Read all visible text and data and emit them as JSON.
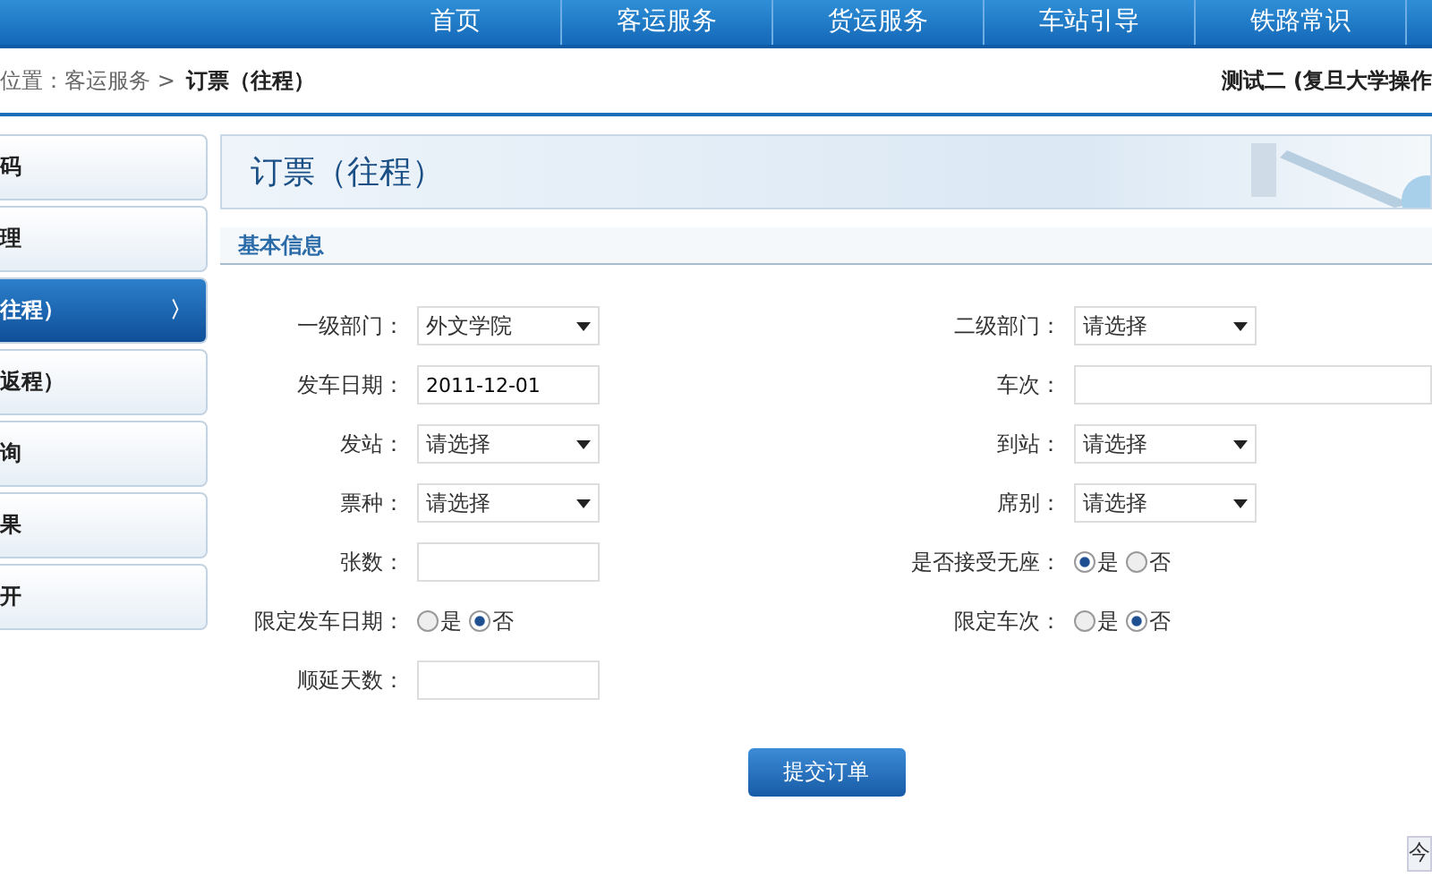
{
  "nav": [
    {
      "label": "首页"
    },
    {
      "label": "客运服务"
    },
    {
      "label": "货运服务"
    },
    {
      "label": "车站引导"
    },
    {
      "label": "铁路常识"
    }
  ],
  "breadcrumb": {
    "path": "位置：客运服务",
    "separator": ">",
    "current": "订票（往程）"
  },
  "user": "测试二 (复旦大学操作",
  "sidebar": {
    "items": [
      {
        "label": "码",
        "selected": false
      },
      {
        "label": "理",
        "selected": false
      },
      {
        "label": "往程）",
        "selected": true,
        "arrow": "〉"
      },
      {
        "label": "返程）",
        "selected": false
      },
      {
        "label": "询",
        "selected": false
      },
      {
        "label": "果",
        "selected": false
      },
      {
        "label": "开",
        "selected": false
      }
    ]
  },
  "page_title": "订票（往程）",
  "section_title": "基本信息",
  "form_rows": [
    {
      "left": {
        "label": "一级部门：",
        "kind": "select",
        "value": "外文学院"
      },
      "right": {
        "label": "二级部门：",
        "kind": "select",
        "value": "请选择"
      }
    },
    {
      "left": {
        "label": "发车日期：",
        "kind": "text",
        "value": "2011-12-01"
      },
      "right": {
        "label": "车次：",
        "kind": "wide"
      }
    },
    {
      "left": {
        "label": "发站：",
        "kind": "select",
        "value": "请选择"
      },
      "right": {
        "label": "到站：",
        "kind": "select",
        "value": "请选择"
      }
    },
    {
      "left": {
        "label": "票种：",
        "kind": "select",
        "value": "请选择"
      },
      "right": {
        "label": "席别：",
        "kind": "select",
        "value": "请选择"
      }
    },
    {
      "left": {
        "label": "张数：",
        "kind": "text"
      },
      "right": {
        "label": "是否接受无座：",
        "kind": "radio",
        "options": [
          {
            "label": "是",
            "selected": true
          },
          {
            "label": "否",
            "selected": false
          }
        ]
      }
    },
    {
      "left": {
        "label": "限定发车日期：",
        "kind": "radio",
        "options": [
          {
            "label": "是",
            "selected": false
          },
          {
            "label": "否",
            "selected": true
          }
        ]
      },
      "right": {
        "label": "限定车次：",
        "kind": "radio",
        "options": [
          {
            "label": "是",
            "selected": false
          },
          {
            "label": "否",
            "selected": true
          }
        ]
      }
    },
    {
      "left": {
        "label": "顺延天数：",
        "kind": "text"
      }
    }
  ],
  "submit": "提交订单",
  "corner_tab": "今"
}
